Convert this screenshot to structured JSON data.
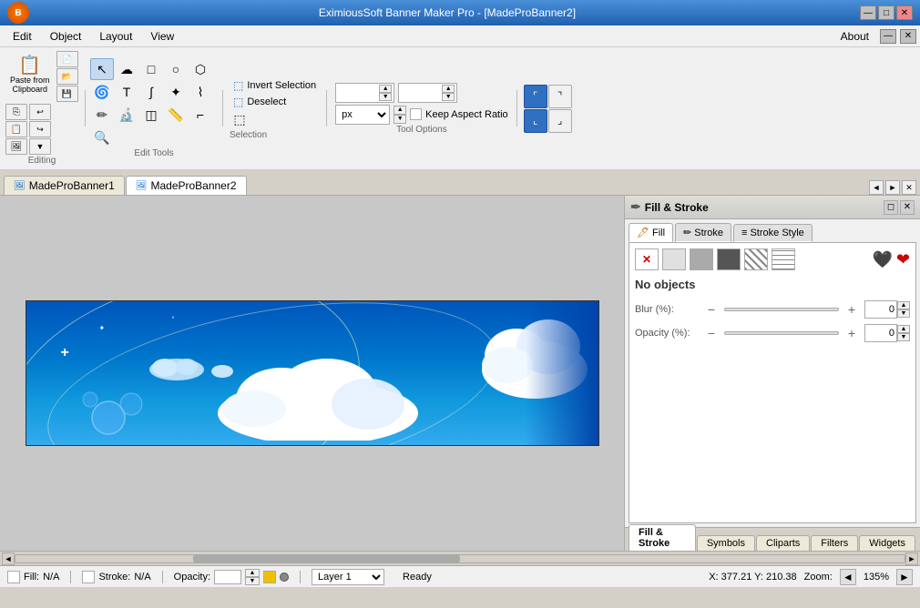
{
  "titleBar": {
    "title": "EximiousSoft Banner Maker Pro - [MadeProBanner2]",
    "controls": [
      "—",
      "□",
      "✕"
    ]
  },
  "menuBar": {
    "items": [
      "Edit",
      "Object",
      "Layout",
      "View"
    ],
    "about": "About",
    "controls": [
      "—",
      "✕"
    ]
  },
  "toolbar": {
    "pasteFromClipboard": "Paste from\nClipboard",
    "editingLabel": "Editing",
    "editToolsLabel": "Edit Tools",
    "selectionLabel": "Selection",
    "invertSelection": "Invert Selection",
    "deselect": "Deselect",
    "toolOptionsLabel": "Tool Options",
    "pixelUnit": "px",
    "keepAspectRatio": "Keep Aspect Ratio",
    "widthValue": "",
    "heightValue": ""
  },
  "tabs": {
    "tab1": "MadeProBanner1",
    "tab2": "MadeProBanner2",
    "active": "tab2"
  },
  "fillStroke": {
    "panelTitle": "Fill & Stroke",
    "fillTab": "Fill",
    "strokeTab": "Stroke",
    "strokeStyleTab": "Stroke Style",
    "noObjects": "No objects",
    "blurLabel": "Blur (%):",
    "blurValue": "0",
    "opacityLabel": "Opacity (%):",
    "opacityValue": "0"
  },
  "bottomTabs": {
    "tabs": [
      "Fill & Stroke",
      "Symbols",
      "Cliparts",
      "Filters",
      "Widgets"
    ]
  },
  "statusBar": {
    "fillLabel": "Fill:",
    "fillValue": "N/A",
    "strokeLabel": "Stroke:",
    "strokeValue": "N/A",
    "opacityLabel": "Opacity:",
    "layerLabel": "Layer 1",
    "readyLabel": "Ready",
    "coords": "X: 377.21 Y: 210.38",
    "zoomLabel": "Zoom:",
    "zoomValue": "135%"
  }
}
